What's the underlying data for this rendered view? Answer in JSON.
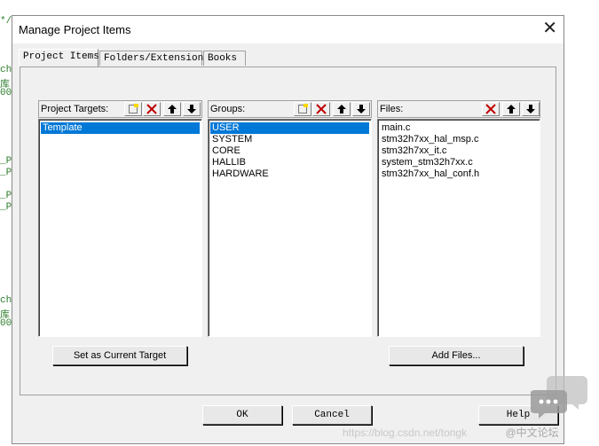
{
  "background_code": {
    "lines": [
      "*/",
      "ch",
      "库",
      "00",
      "_P",
      "_P",
      "_P",
      "_P",
      "ch",
      "库",
      "00"
    ]
  },
  "dialog": {
    "title": "Manage Project Items",
    "close_glyph": "✕",
    "tabs": [
      {
        "label": "Project Items",
        "active": true
      },
      {
        "label": "Folders/Extensions",
        "active": false
      },
      {
        "label": "Books",
        "active": false
      }
    ]
  },
  "targets": {
    "header": "Project Targets:",
    "items": [
      {
        "label": "Template",
        "selected": true
      }
    ],
    "set_current_button": "Set as Current Target"
  },
  "groups": {
    "header": "Groups:",
    "items": [
      {
        "label": "USER",
        "selected": true
      },
      {
        "label": "SYSTEM",
        "selected": false
      },
      {
        "label": "CORE",
        "selected": false
      },
      {
        "label": "HALLIB",
        "selected": false
      },
      {
        "label": "HARDWARE",
        "selected": false
      }
    ]
  },
  "files": {
    "header": "Files:",
    "items": [
      {
        "label": "main.c"
      },
      {
        "label": "stm32h7xx_hal_msp.c"
      },
      {
        "label": "stm32h7xx_it.c"
      },
      {
        "label": "system_stm32h7xx.c"
      },
      {
        "label": "stm32h7xx_hal_conf.h"
      }
    ],
    "add_button": "Add Files..."
  },
  "footer": {
    "ok": "OK",
    "cancel": "Cancel",
    "help": "Help"
  },
  "icons": {
    "new": "new-item-icon",
    "delete": "delete-x-icon",
    "up": "move-up-icon",
    "down": "move-down-icon"
  },
  "colors": {
    "selection": "#0078d7",
    "delete_red": "#c00000"
  },
  "watermark": {
    "url": "https://blog.csdn.net/tongk",
    "cn": "@中文论坛"
  }
}
